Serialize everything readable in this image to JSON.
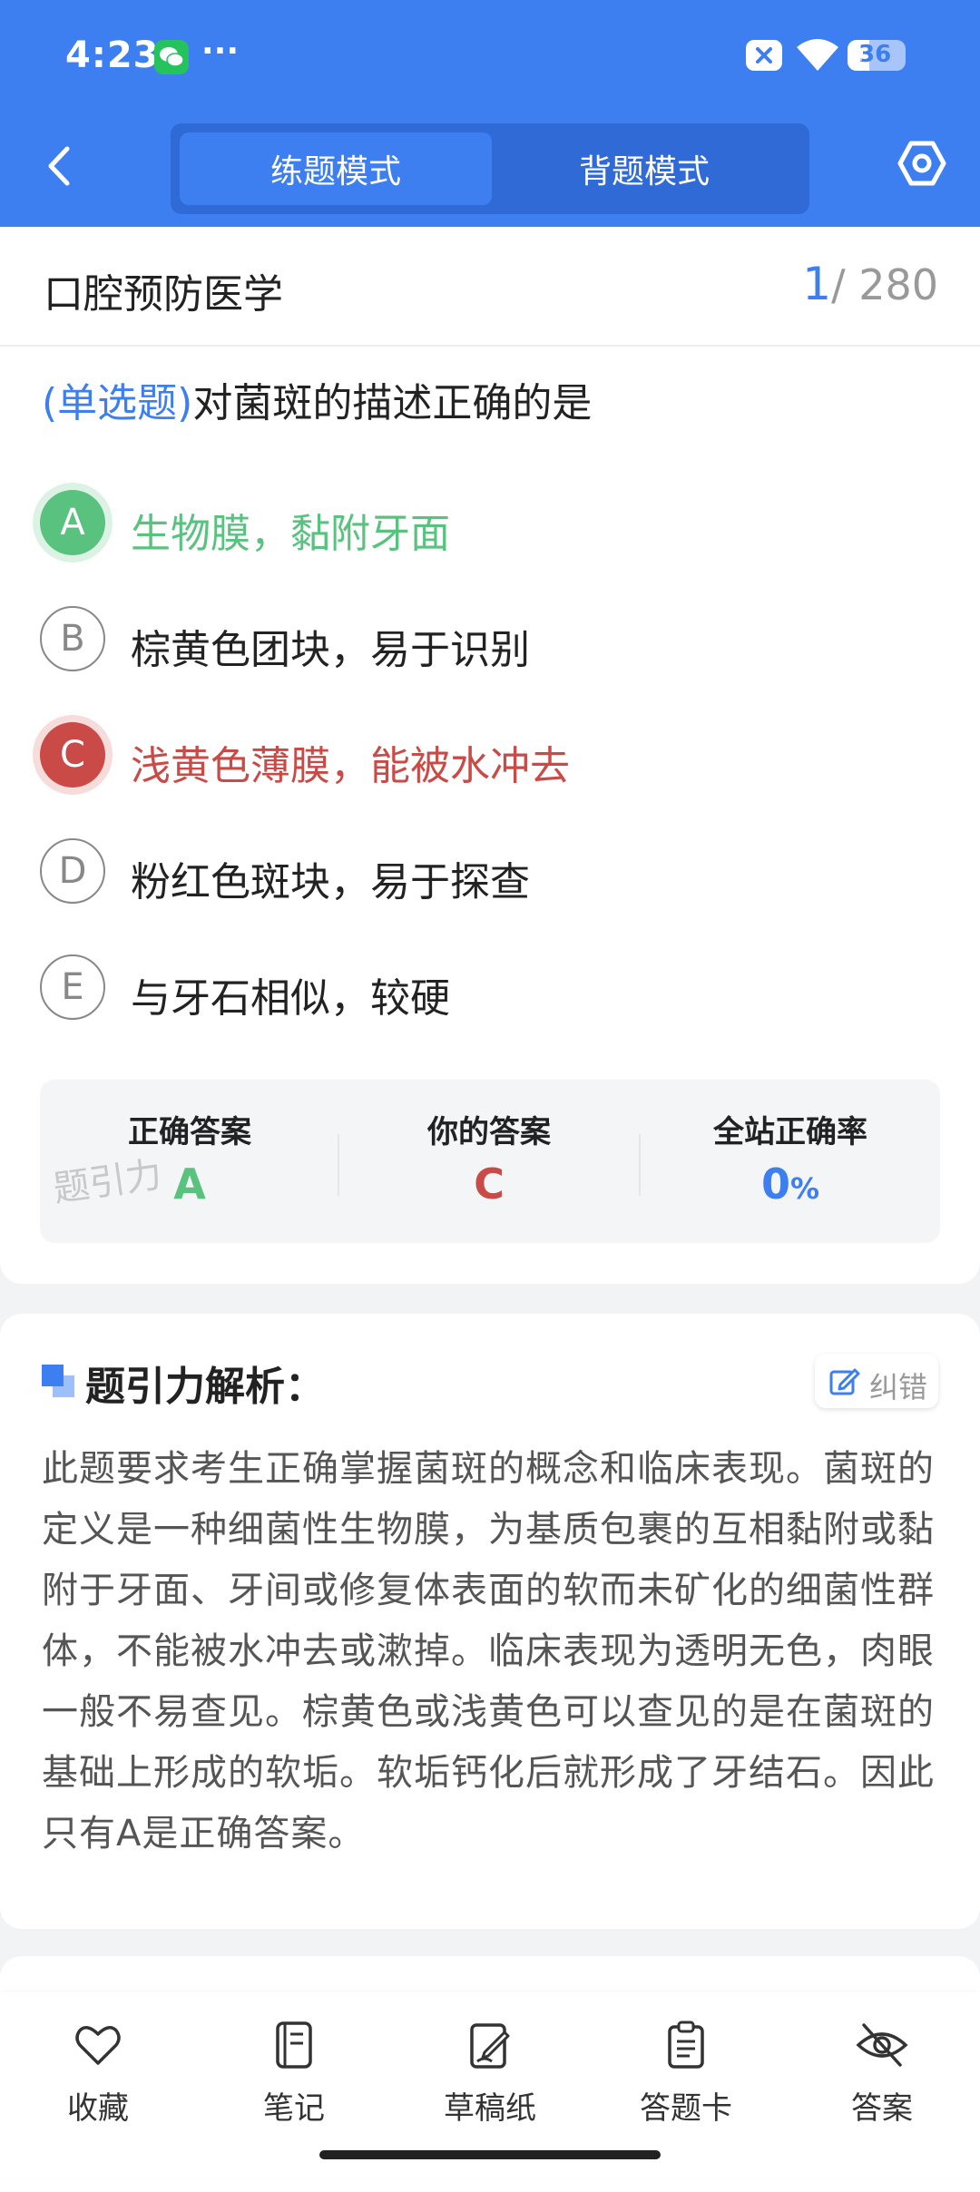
{
  "status_bar": {
    "time": "4:23",
    "dots": "···",
    "battery": "36"
  },
  "header": {
    "tabs": [
      {
        "label": "练题模式",
        "active": true
      },
      {
        "label": "背题模式",
        "active": false
      }
    ]
  },
  "subject": {
    "name": "口腔预防医学",
    "current": "1",
    "total": "/ 280"
  },
  "question": {
    "type": "(单选题)",
    "text": "对菌斑的描述正确的是",
    "options": [
      {
        "letter": "A",
        "text": "生物膜，黏附牙面",
        "state": "correct"
      },
      {
        "letter": "B",
        "text": "棕黄色团块，易于识别",
        "state": "normal"
      },
      {
        "letter": "C",
        "text": "浅黄色薄膜，能被水冲去",
        "state": "wrong"
      },
      {
        "letter": "D",
        "text": "粉红色斑块，易于探查",
        "state": "normal"
      },
      {
        "letter": "E",
        "text": "与牙石相似，较硬",
        "state": "normal"
      }
    ]
  },
  "answers": {
    "correct_label": "正确答案",
    "correct_value": "A",
    "yours_label": "你的答案",
    "yours_value": "C",
    "rate_label": "全站正确率",
    "rate_value": "0",
    "rate_unit": "%",
    "watermark": "题引力"
  },
  "analysis": {
    "title": "题引力解析：",
    "report_label": "纠错",
    "text": "此题要求考生正确掌握菌斑的概念和临床表现。菌斑的定义是一种细菌性生物膜，为基质包裹的互相黏附或黏附于牙面、牙间或修复体表面的软而未矿化的细菌性群体，不能被水冲去或漱掉。临床表现为透明无色，肉眼一般不易查见。棕黄色或浅黄色可以查见的是在菌斑的基础上形成的软垢。软垢钙化后就形成了牙结石。因此只有A是正确答案。"
  },
  "toolbar": {
    "items": [
      {
        "label": "收藏",
        "icon": "heart-icon"
      },
      {
        "label": "笔记",
        "icon": "notebook-icon"
      },
      {
        "label": "草稿纸",
        "icon": "draft-icon"
      },
      {
        "label": "答题卡",
        "icon": "clipboard-icon"
      },
      {
        "label": "答案",
        "icon": "eye-off-icon"
      }
    ]
  },
  "colors": {
    "brand": "#3d7ff0",
    "correct": "#5ac27f",
    "wrong": "#c94a46"
  }
}
